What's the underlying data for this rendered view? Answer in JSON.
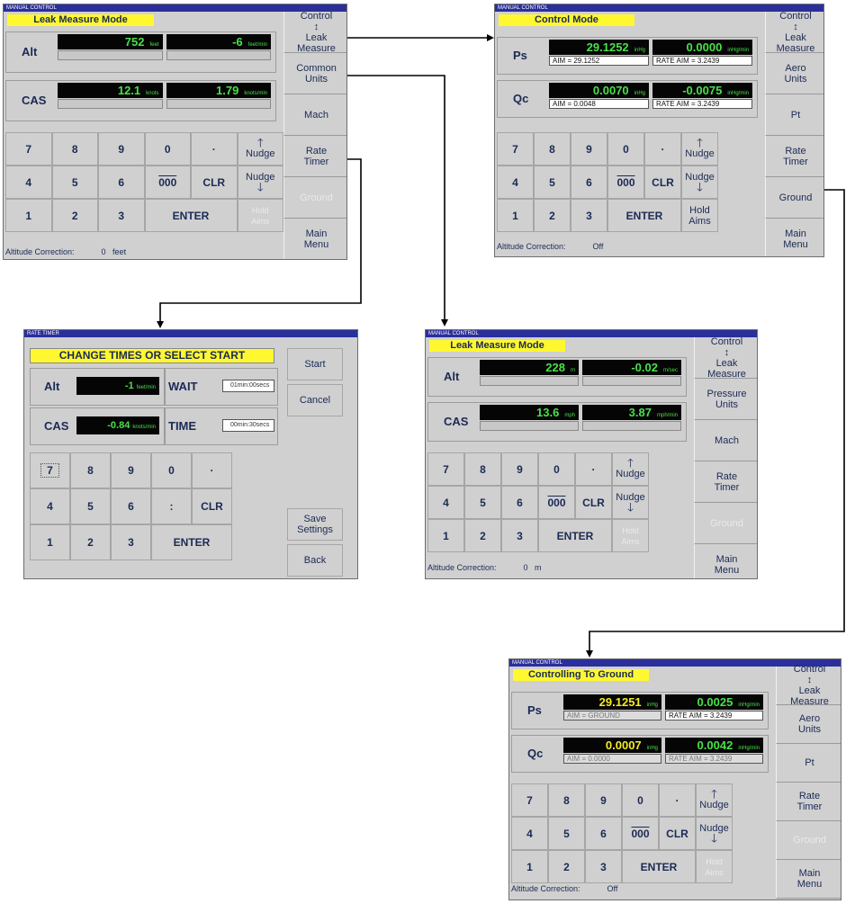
{
  "panel1": {
    "title": "MANUAL CONTROL",
    "mode": "Leak Measure Mode",
    "rows": [
      {
        "label": "Alt",
        "value": "752",
        "unit": "feet",
        "rate": "-6",
        "rate_unit": "feet/min"
      },
      {
        "label": "CAS",
        "value": "12.1",
        "unit": "knots",
        "rate": "1.79",
        "rate_unit": "knots/min"
      }
    ],
    "side": [
      {
        "label": "Control\n↕\nLeak\nMeasure",
        "enabled": true
      },
      {
        "label": "Common\nUnits",
        "enabled": true
      },
      {
        "label": "Mach",
        "enabled": true
      },
      {
        "label": "Rate\nTimer",
        "enabled": true
      },
      {
        "label": "Ground",
        "enabled": false
      },
      {
        "label": "Main\nMenu",
        "enabled": true
      }
    ],
    "footer_label": "Altitude Correction:",
    "footer_value": "0   feet"
  },
  "panel2": {
    "title": "MANUAL CONTROL",
    "mode": "Control Mode",
    "rows": [
      {
        "label": "Ps",
        "value": "29.1252",
        "unit": "inHg",
        "rate": "0.0000",
        "rate_unit": "inHg/min",
        "aim": "AIM =  29.1252",
        "rate_aim": "RATE AIM =   3.2439"
      },
      {
        "label": "Qc",
        "value": "0.0070",
        "unit": "inHg",
        "rate": "-0.0075",
        "rate_unit": "inHg/min",
        "aim": "AIM =  0.0048",
        "rate_aim": "RATE AIM =   3.2439"
      }
    ],
    "side": [
      {
        "label": "Control\n↕\nLeak\nMeasure",
        "enabled": true
      },
      {
        "label": "Aero\nUnits",
        "enabled": true
      },
      {
        "label": "Pt",
        "enabled": true
      },
      {
        "label": "Rate\nTimer",
        "enabled": true
      },
      {
        "label": "Ground",
        "enabled": true
      },
      {
        "label": "Main\nMenu",
        "enabled": true
      }
    ],
    "footer_label": "Altitude Correction:",
    "footer_value": "Off"
  },
  "panel3": {
    "title": "RATE TIMER",
    "header": "CHANGE TIMES OR SELECT START",
    "rows": [
      {
        "label": "Alt",
        "value": "-1",
        "unit": "feet/min",
        "field_label": "WAIT",
        "field_value": "01min:00secs"
      },
      {
        "label": "CAS",
        "value": "-0.84",
        "unit": "knots/min",
        "field_label": "TIME",
        "field_value": "00min:30secs"
      }
    ],
    "keys": [
      "7",
      "8",
      "9",
      "0",
      "·",
      "4",
      "5",
      "6",
      ":",
      "CLR",
      "1",
      "2",
      "3",
      "ENTER"
    ],
    "side": [
      "Start",
      "Cancel",
      "Save\nSettings",
      "Back"
    ]
  },
  "panel4": {
    "title": "MANUAL CONTROL",
    "mode": "Leak Measure Mode",
    "rows": [
      {
        "label": "Alt",
        "value": "228",
        "unit": "m",
        "rate": "-0.02",
        "rate_unit": "m/sec"
      },
      {
        "label": "CAS",
        "value": "13.6",
        "unit": "mph",
        "rate": "3.87",
        "rate_unit": "mph/min"
      }
    ],
    "side": [
      {
        "label": "Control\n↕\nLeak\nMeasure",
        "enabled": true
      },
      {
        "label": "Pressure\nUnits",
        "enabled": true
      },
      {
        "label": "Mach",
        "enabled": true
      },
      {
        "label": "Rate\nTimer",
        "enabled": true
      },
      {
        "label": "Ground",
        "enabled": false
      },
      {
        "label": "Main\nMenu",
        "enabled": true
      }
    ],
    "footer_label": "Altitude Correction:",
    "footer_value": "0   m"
  },
  "panel5": {
    "title": "MANUAL CONTROL",
    "mode": "Controlling To Ground",
    "rows": [
      {
        "label": "Ps",
        "value": "29.1251",
        "unit": "inHg",
        "rate": "0.0025",
        "rate_unit": "inHg/min",
        "aim": "AIM = GROUND",
        "rate_aim": "RATE AIM =   3.2439"
      },
      {
        "label": "Qc",
        "value": "0.0007",
        "unit": "inHg",
        "rate": "0.0042",
        "rate_unit": "inHg/min",
        "aim": "AIM =  0.0000",
        "rate_aim": "RATE AIM =  3.2439"
      }
    ],
    "side": [
      {
        "label": "Control\n↕\nLeak\nMeasure",
        "enabled": true
      },
      {
        "label": "Aero\nUnits",
        "enabled": true
      },
      {
        "label": "Pt",
        "enabled": true
      },
      {
        "label": "Rate\nTimer",
        "enabled": true
      },
      {
        "label": "Ground",
        "enabled": false
      },
      {
        "label": "Main\nMenu",
        "enabled": true
      }
    ],
    "footer_label": "Altitude Correction:",
    "footer_value": "Off"
  },
  "keypad": {
    "keys": [
      "7",
      "8",
      "9",
      "0",
      "·",
      "4",
      "5",
      "6",
      "000",
      "CLR",
      "1",
      "2",
      "3",
      "ENTER"
    ],
    "nudge": "Nudge",
    "hold_aims": "Hold\nAims"
  }
}
